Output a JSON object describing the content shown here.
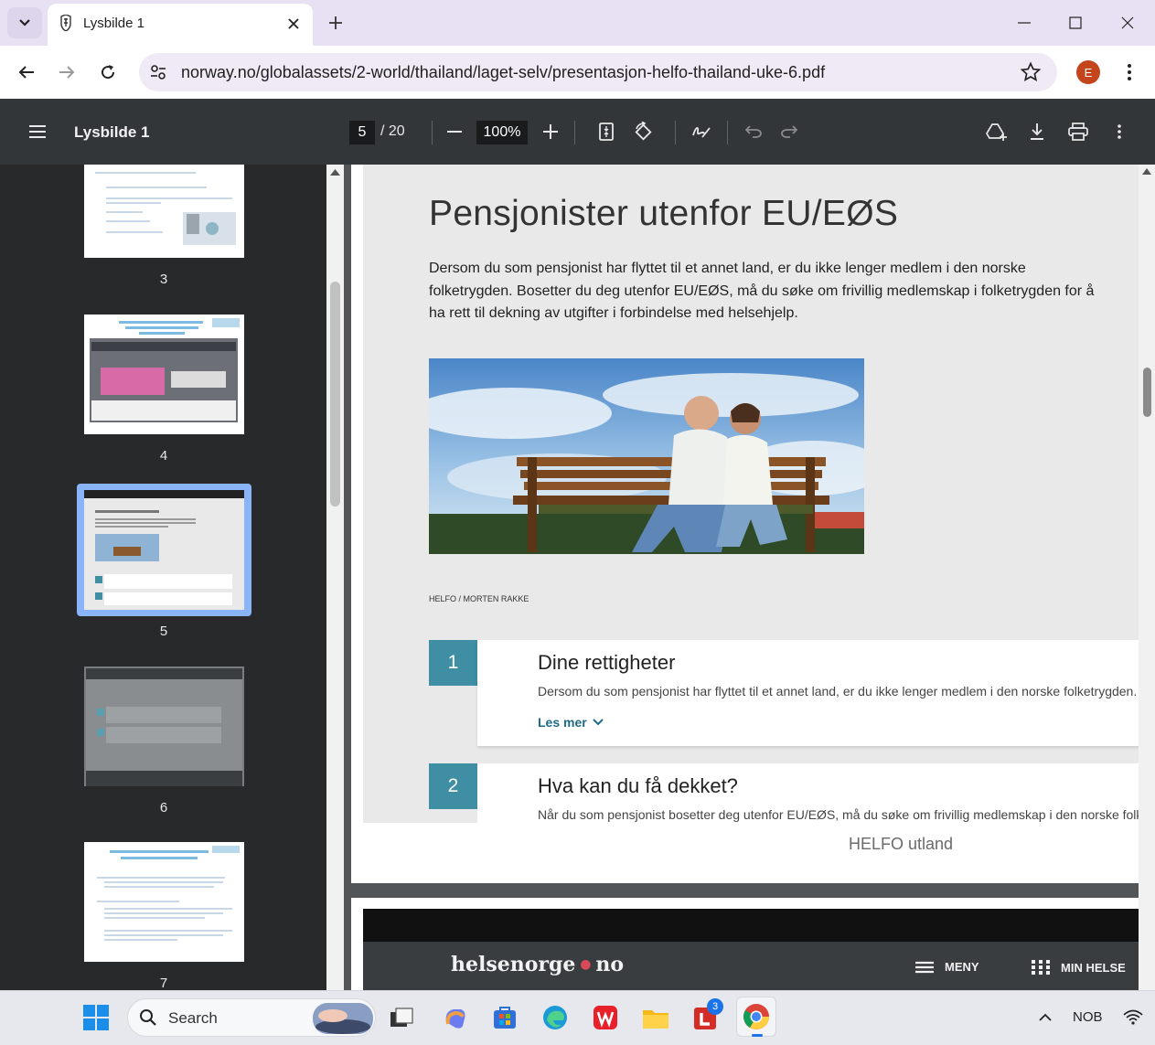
{
  "browser": {
    "tab_title": "Lysbilde 1",
    "url": "norway.no/globalassets/2-world/thailand/laget-selv/presentasjon-helfo-thailand-uke-6.pdf",
    "profile_initial": "E"
  },
  "pdf_toolbar": {
    "title": "Lysbilde 1",
    "current_page": "5",
    "total_pages": "/ 20",
    "zoom": "100%"
  },
  "thumbnails": [
    {
      "label": "3"
    },
    {
      "label": "4"
    },
    {
      "label": "5",
      "selected": true
    },
    {
      "label": "6"
    },
    {
      "label": "7"
    }
  ],
  "slide": {
    "title": "Pensjonister utenfor EU/EØS",
    "intro": "Dersom du som pensjonist har flyttet til et annet land, er du ikke lenger medlem i den norske folketrygden. Bosetter du deg utenfor EU/EØS, må du søke om frivillig medlemskap i folketrygden for å ha rett til dekning av utgifter i forbindelse med helsehjelp.",
    "photo_credit": "HELFO / MORTEN RAKKE",
    "cards": [
      {
        "number": "1",
        "title": "Dine rettigheter",
        "text": "Dersom du som pensjonist har flyttet til et annet land, er du ikke lenger medlem i den norske folketrygden.",
        "link": "Les mer"
      },
      {
        "number": "2",
        "title": "Hva kan du få dekket?",
        "text": "Når du som pensjonist bosetter deg utenfor EU/EØS, må du søke om frivillig medlemskap i den norske folketrygde"
      }
    ],
    "footer": "HELFO utland"
  },
  "next_page": {
    "logo": "helsenorge",
    "logo_suffix": "no",
    "menu_label": "MENY",
    "my_health_label": "MIN HELSE"
  },
  "taskbar": {
    "search_label": "Search",
    "language": "NOB",
    "badge_count": "3"
  },
  "colors": {
    "card_accent": "#3f8ea3",
    "pdf_toolbar": "#333639",
    "selected_thumb": "#8ab4f8"
  }
}
